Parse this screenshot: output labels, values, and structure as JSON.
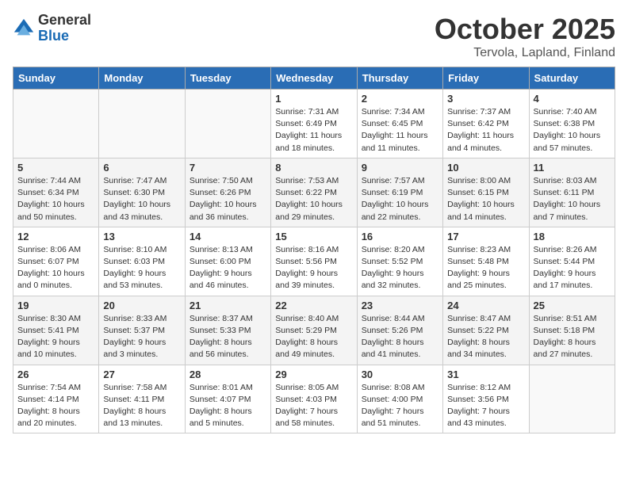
{
  "logo": {
    "general": "General",
    "blue": "Blue"
  },
  "header": {
    "month": "October 2025",
    "location": "Tervola, Lapland, Finland"
  },
  "weekdays": [
    "Sunday",
    "Monday",
    "Tuesday",
    "Wednesday",
    "Thursday",
    "Friday",
    "Saturday"
  ],
  "weeks": [
    [
      {
        "day": "",
        "info": ""
      },
      {
        "day": "",
        "info": ""
      },
      {
        "day": "",
        "info": ""
      },
      {
        "day": "1",
        "info": "Sunrise: 7:31 AM\nSunset: 6:49 PM\nDaylight: 11 hours\nand 18 minutes."
      },
      {
        "day": "2",
        "info": "Sunrise: 7:34 AM\nSunset: 6:45 PM\nDaylight: 11 hours\nand 11 minutes."
      },
      {
        "day": "3",
        "info": "Sunrise: 7:37 AM\nSunset: 6:42 PM\nDaylight: 11 hours\nand 4 minutes."
      },
      {
        "day": "4",
        "info": "Sunrise: 7:40 AM\nSunset: 6:38 PM\nDaylight: 10 hours\nand 57 minutes."
      }
    ],
    [
      {
        "day": "5",
        "info": "Sunrise: 7:44 AM\nSunset: 6:34 PM\nDaylight: 10 hours\nand 50 minutes."
      },
      {
        "day": "6",
        "info": "Sunrise: 7:47 AM\nSunset: 6:30 PM\nDaylight: 10 hours\nand 43 minutes."
      },
      {
        "day": "7",
        "info": "Sunrise: 7:50 AM\nSunset: 6:26 PM\nDaylight: 10 hours\nand 36 minutes."
      },
      {
        "day": "8",
        "info": "Sunrise: 7:53 AM\nSunset: 6:22 PM\nDaylight: 10 hours\nand 29 minutes."
      },
      {
        "day": "9",
        "info": "Sunrise: 7:57 AM\nSunset: 6:19 PM\nDaylight: 10 hours\nand 22 minutes."
      },
      {
        "day": "10",
        "info": "Sunrise: 8:00 AM\nSunset: 6:15 PM\nDaylight: 10 hours\nand 14 minutes."
      },
      {
        "day": "11",
        "info": "Sunrise: 8:03 AM\nSunset: 6:11 PM\nDaylight: 10 hours\nand 7 minutes."
      }
    ],
    [
      {
        "day": "12",
        "info": "Sunrise: 8:06 AM\nSunset: 6:07 PM\nDaylight: 10 hours\nand 0 minutes."
      },
      {
        "day": "13",
        "info": "Sunrise: 8:10 AM\nSunset: 6:03 PM\nDaylight: 9 hours\nand 53 minutes."
      },
      {
        "day": "14",
        "info": "Sunrise: 8:13 AM\nSunset: 6:00 PM\nDaylight: 9 hours\nand 46 minutes."
      },
      {
        "day": "15",
        "info": "Sunrise: 8:16 AM\nSunset: 5:56 PM\nDaylight: 9 hours\nand 39 minutes."
      },
      {
        "day": "16",
        "info": "Sunrise: 8:20 AM\nSunset: 5:52 PM\nDaylight: 9 hours\nand 32 minutes."
      },
      {
        "day": "17",
        "info": "Sunrise: 8:23 AM\nSunset: 5:48 PM\nDaylight: 9 hours\nand 25 minutes."
      },
      {
        "day": "18",
        "info": "Sunrise: 8:26 AM\nSunset: 5:44 PM\nDaylight: 9 hours\nand 17 minutes."
      }
    ],
    [
      {
        "day": "19",
        "info": "Sunrise: 8:30 AM\nSunset: 5:41 PM\nDaylight: 9 hours\nand 10 minutes."
      },
      {
        "day": "20",
        "info": "Sunrise: 8:33 AM\nSunset: 5:37 PM\nDaylight: 9 hours\nand 3 minutes."
      },
      {
        "day": "21",
        "info": "Sunrise: 8:37 AM\nSunset: 5:33 PM\nDaylight: 8 hours\nand 56 minutes."
      },
      {
        "day": "22",
        "info": "Sunrise: 8:40 AM\nSunset: 5:29 PM\nDaylight: 8 hours\nand 49 minutes."
      },
      {
        "day": "23",
        "info": "Sunrise: 8:44 AM\nSunset: 5:26 PM\nDaylight: 8 hours\nand 41 minutes."
      },
      {
        "day": "24",
        "info": "Sunrise: 8:47 AM\nSunset: 5:22 PM\nDaylight: 8 hours\nand 34 minutes."
      },
      {
        "day": "25",
        "info": "Sunrise: 8:51 AM\nSunset: 5:18 PM\nDaylight: 8 hours\nand 27 minutes."
      }
    ],
    [
      {
        "day": "26",
        "info": "Sunrise: 7:54 AM\nSunset: 4:14 PM\nDaylight: 8 hours\nand 20 minutes."
      },
      {
        "day": "27",
        "info": "Sunrise: 7:58 AM\nSunset: 4:11 PM\nDaylight: 8 hours\nand 13 minutes."
      },
      {
        "day": "28",
        "info": "Sunrise: 8:01 AM\nSunset: 4:07 PM\nDaylight: 8 hours\nand 5 minutes."
      },
      {
        "day": "29",
        "info": "Sunrise: 8:05 AM\nSunset: 4:03 PM\nDaylight: 7 hours\nand 58 minutes."
      },
      {
        "day": "30",
        "info": "Sunrise: 8:08 AM\nSunset: 4:00 PM\nDaylight: 7 hours\nand 51 minutes."
      },
      {
        "day": "31",
        "info": "Sunrise: 8:12 AM\nSunset: 3:56 PM\nDaylight: 7 hours\nand 43 minutes."
      },
      {
        "day": "",
        "info": ""
      }
    ]
  ]
}
